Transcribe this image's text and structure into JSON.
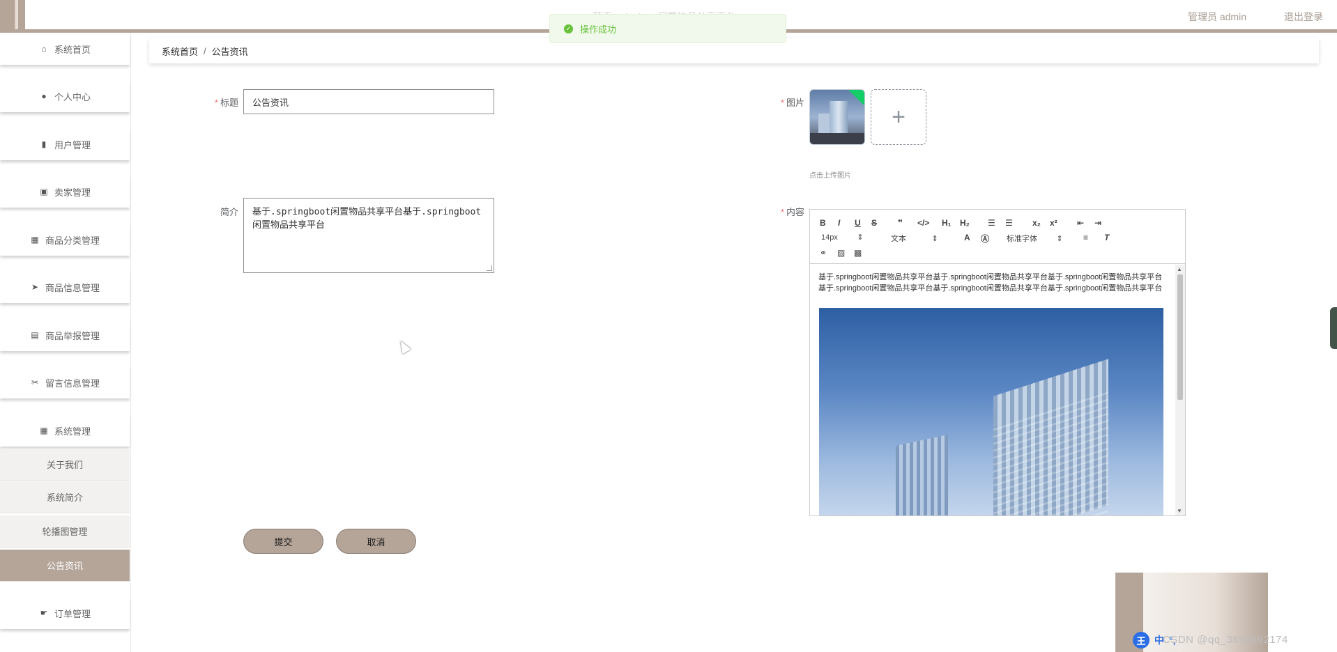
{
  "header": {
    "app_title": "基于springboot闲置物品共享平台",
    "user": "管理员 admin",
    "logout": "退出登录"
  },
  "toast": {
    "message": "操作成功"
  },
  "sidebar": {
    "items": [
      {
        "label": "系统首页",
        "icon": "home-icon"
      },
      {
        "label": "个人中心",
        "icon": "user-icon"
      },
      {
        "label": "用户管理",
        "icon": "book-icon"
      },
      {
        "label": "卖家管理",
        "icon": "chart-icon"
      },
      {
        "label": "商品分类管理",
        "icon": "grid-icon"
      },
      {
        "label": "商品信息管理",
        "icon": "send-icon"
      },
      {
        "label": "商品举报管理",
        "icon": "clipboard-icon"
      },
      {
        "label": "留言信息管理",
        "icon": "ticket-icon"
      },
      {
        "label": "系统管理",
        "icon": "grid-icon"
      }
    ],
    "sub_items": [
      "关于我们",
      "系统简介",
      "轮播图管理",
      "公告资讯"
    ],
    "order": {
      "label": "订单管理",
      "icon": "thumb-icon"
    }
  },
  "breadcrumb": {
    "home": "系统首页",
    "sep": "/",
    "current": "公告资讯"
  },
  "form": {
    "title_label": "标题",
    "title_value": "公告资讯",
    "intro_label": "简介",
    "intro_value": "基于.springboot闲置物品共享平台基于.springboot闲置物品共享平台",
    "image_label": "图片",
    "upload_tip": "点击上传图片",
    "content_label": "内容",
    "content_text": "基于.springboot闲置物品共享平台基于.springboot闲置物品共享平台基于.springboot闲置物品共享平台基于.springboot闲置物品共享平台基于.springboot闲置物品共享平台基于.springboot闲置物品共享平台",
    "submit": "提交",
    "cancel": "取消"
  },
  "editor": {
    "font_size": "14px",
    "block": "文本",
    "font": "标准字体"
  },
  "watermark": "CSDN @qq_3659892174",
  "ime": {
    "logo": "王",
    "mode": "中"
  }
}
